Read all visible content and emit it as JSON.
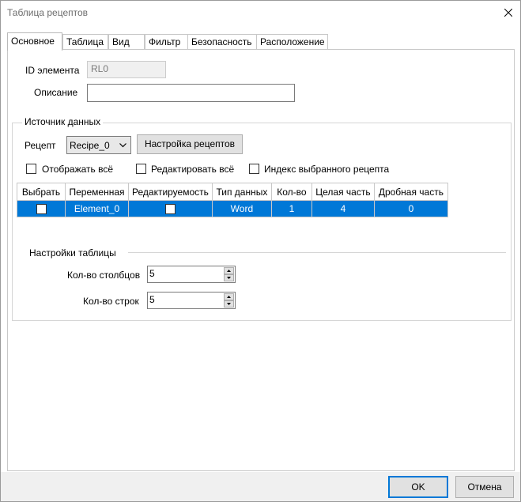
{
  "window": {
    "title": "Таблица рецептов"
  },
  "tabs": [
    {
      "label": "Основное"
    },
    {
      "label": "Таблица"
    },
    {
      "label": "Вид"
    },
    {
      "label": "Фильтр"
    },
    {
      "label": "Безопасность"
    },
    {
      "label": "Расположение"
    }
  ],
  "general": {
    "element_id_label": "ID элемента",
    "element_id_value": "RL0",
    "description_label": "Описание",
    "description_value": ""
  },
  "datasource": {
    "group_label": "Источник данных",
    "recipe_label": "Рецепт",
    "recipe_value": "Recipe_0",
    "recipe_settings_button": "Настройка рецептов",
    "show_all_label": "Отображать всё",
    "edit_all_label": "Редактировать всё",
    "recipe_index_label": "Индекс выбранного рецепта",
    "columns": [
      "Выбрать",
      "Переменная",
      "Редактируемость",
      "Тип данных",
      "Кол-во",
      "Целая часть",
      "Дробная часть"
    ],
    "rows": [
      {
        "variable": "Element_0",
        "datatype": "Word",
        "count": "1",
        "integer_part": "4",
        "fraction_part": "0"
      }
    ]
  },
  "table_settings": {
    "group_label": "Настройки таблицы",
    "columns_label": "Кол-во столбцов",
    "columns_value": "5",
    "rows_label": "Кол-во строк",
    "rows_value": "5"
  },
  "footer": {
    "ok_label": "OK",
    "cancel_label": "Отмена"
  },
  "colors": {
    "selection": "#0078d7"
  }
}
